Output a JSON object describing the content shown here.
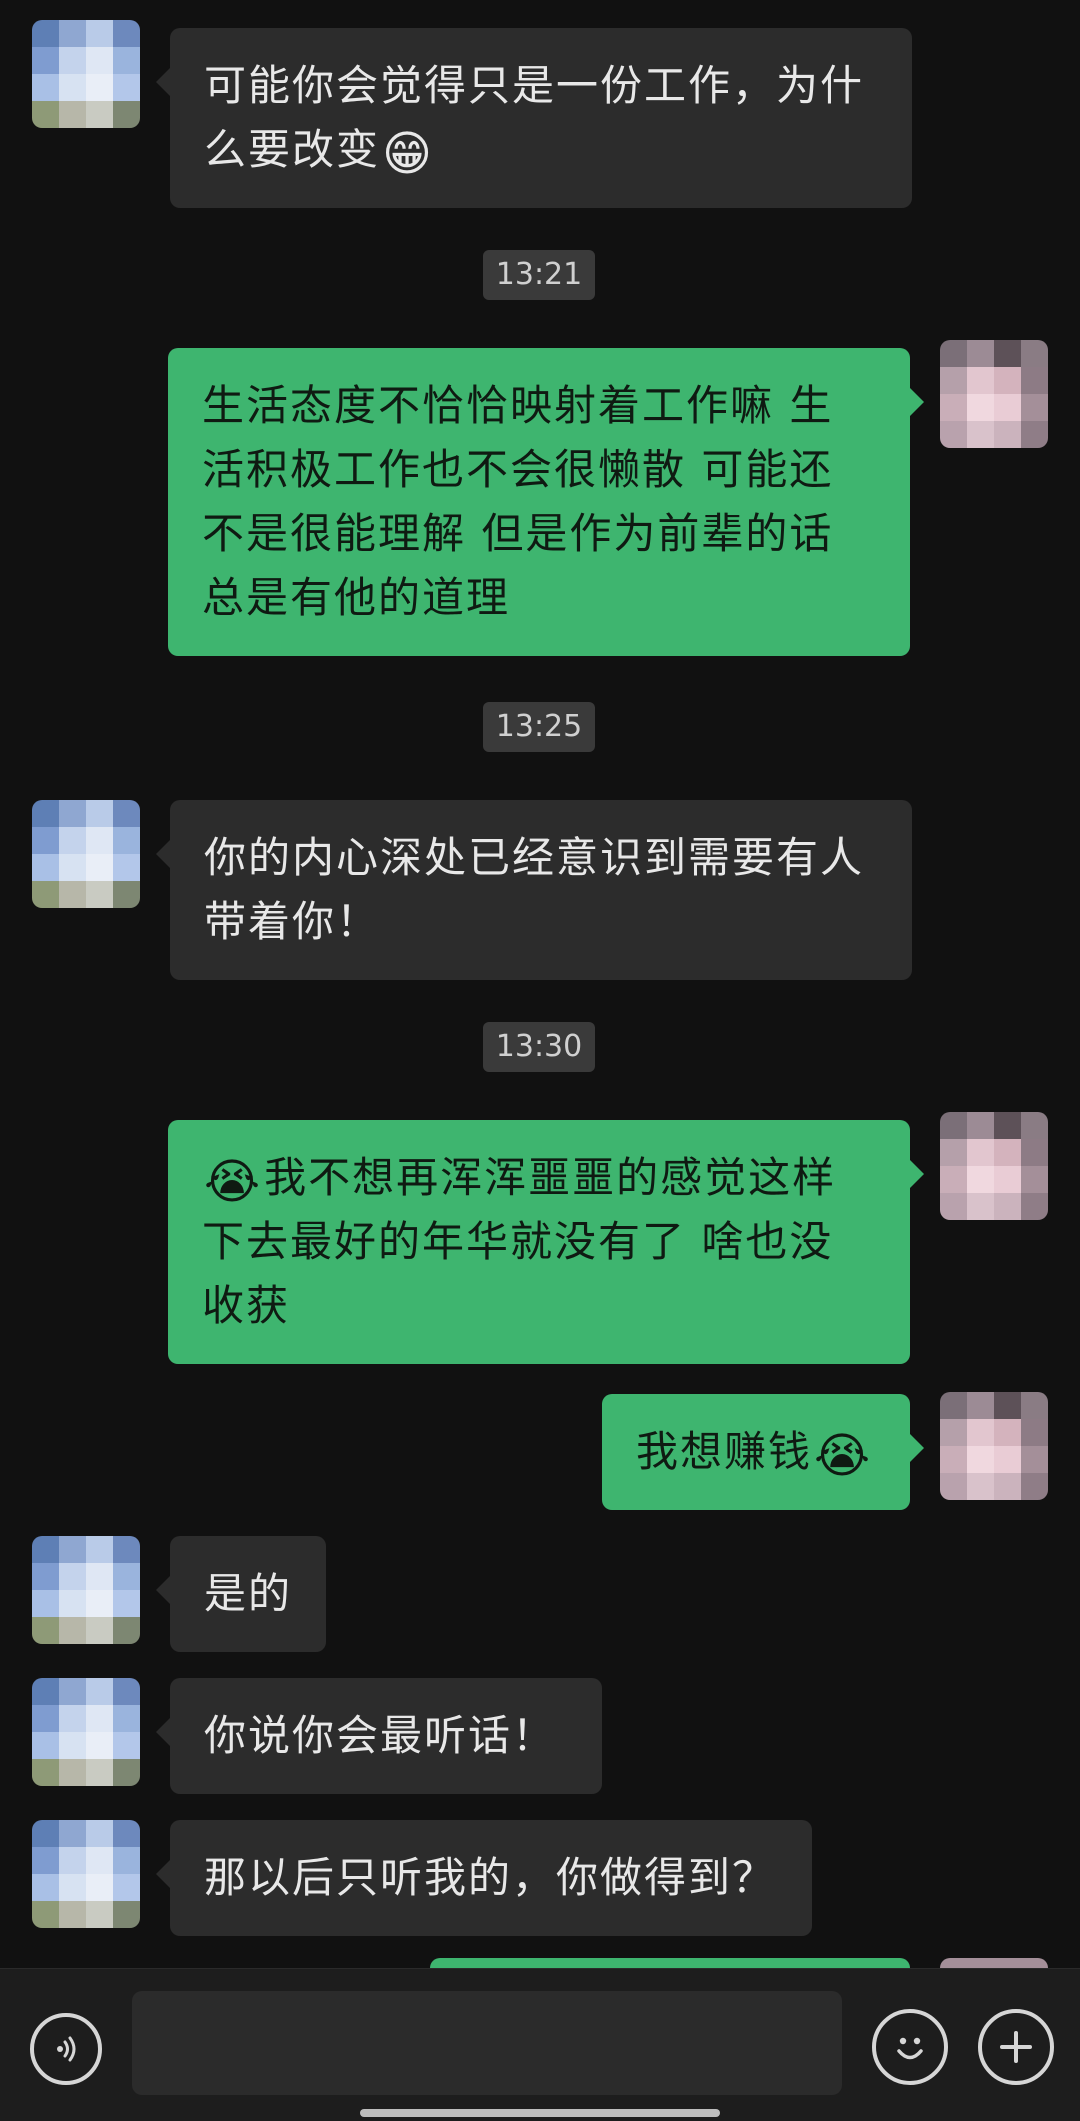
{
  "messages": [
    {
      "side": "left",
      "text": "可能你会觉得只是一份工作，为什么要改变",
      "emoji": "😁"
    },
    {
      "side": "time",
      "text": "13:21"
    },
    {
      "side": "right",
      "text": "生活态度不恰恰映射着工作嘛 生活积极工作也不会很懒散 可能还不是很能理解 但是作为前辈的话总是有他的道理"
    },
    {
      "side": "time",
      "text": "13:25"
    },
    {
      "side": "left",
      "text": "你的内心深处已经意识到需要有人带着你！"
    },
    {
      "side": "time",
      "text": "13:30"
    },
    {
      "side": "right",
      "emoji_prefix": "😭",
      "text": "我不想再浑浑噩噩的感觉这样下去最好的年华就没有了 啥也没收获"
    },
    {
      "side": "right",
      "text": "我想赚钱",
      "emoji": "😭"
    },
    {
      "side": "left",
      "text": "是的"
    },
    {
      "side": "left",
      "text": "你说你会最听话！"
    },
    {
      "side": "left",
      "text": "那以后只听我的，你做得到？"
    }
  ],
  "input_bar": {
    "voice_icon": "voice-icon",
    "emoji_icon": "emoji-face-icon",
    "plus_icon": "plus-icon",
    "text_value": ""
  }
}
